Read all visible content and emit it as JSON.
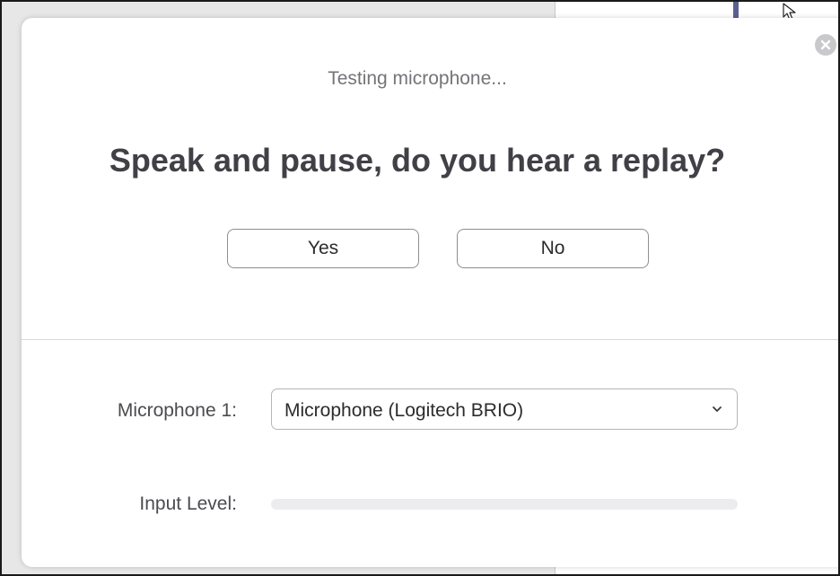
{
  "dialog": {
    "subtitle": "Testing microphone...",
    "headline": "Speak and pause, do you hear a replay?",
    "yes_label": "Yes",
    "no_label": "No"
  },
  "microphone": {
    "label": "Microphone 1:",
    "selected": "Microphone (Logitech BRIO)"
  },
  "input_level": {
    "label": "Input Level:",
    "value": 0
  },
  "icons": {
    "close": "close-icon",
    "dropdown": "chevron-down-icon",
    "cursor": "mouse-pointer-icon"
  },
  "colors": {
    "accent": "#2d8cff",
    "background_accent": "#5a6190"
  }
}
